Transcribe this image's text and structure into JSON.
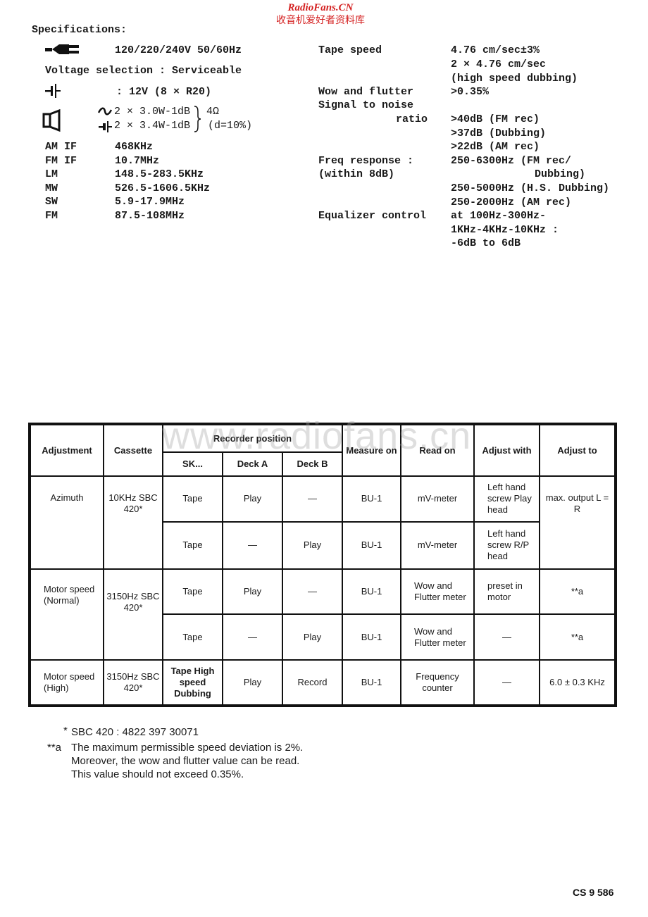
{
  "watermark": {
    "site_en": "RadioFans.CN",
    "site_cn": "收音机爱好者资料库",
    "table_overlay": "www.radiofans.cn"
  },
  "specifications": {
    "heading": "Specifications:",
    "left": {
      "mains": {
        "icon": "mains-plug-icon",
        "value": "120/220/240V 50/60Hz"
      },
      "voltage_selection": "Voltage selection : Serviceable",
      "battery": {
        "icon": "battery-icon",
        "value": ": 12V (8 × R20)"
      },
      "output_power": {
        "icon": "speaker-icon",
        "ac": {
          "icon": "ac-wave-icon",
          "value": "2 × 3.0W-1dB"
        },
        "dc": {
          "icon": "battery-small-icon",
          "value": "2 × 3.4W-1dB"
        },
        "impedance": "4Ω",
        "distortion": "(d=10%)"
      },
      "bands": [
        {
          "label": "AM IF",
          "value": "468KHz"
        },
        {
          "label": "FM IF",
          "value": "10.7MHz"
        },
        {
          "label": "LM",
          "value": "148.5-283.5KHz"
        },
        {
          "label": "MW",
          "value": "526.5-1606.5KHz"
        },
        {
          "label": "SW",
          "value": "5.9-17.9MHz"
        },
        {
          "label": "FM",
          "value": "87.5-108MHz"
        }
      ]
    },
    "right": {
      "tape_speed": {
        "label": "Tape speed",
        "values": [
          "4.76 cm/sec±3%",
          "2 × 4.76 cm/sec",
          "(high speed dubbing)"
        ]
      },
      "wow_flutter": {
        "label": "Wow and flutter",
        "value": ">0.35%"
      },
      "snr": {
        "label_1": "Signal to noise",
        "label_2": "ratio",
        "values": [
          ">40dB (FM rec)",
          ">37dB (Dubbing)",
          ">22dB (AM rec)"
        ]
      },
      "freq_response": {
        "label_1": "Freq response :",
        "label_2": "(within 8dB)",
        "values": [
          "250-6300Hz (FM rec/",
          "Dubbing)",
          "250-5000Hz (H.S. Dubbing)",
          "250-2000Hz (AM rec)"
        ]
      },
      "equalizer": {
        "label": "Equalizer control",
        "values": [
          "at 100Hz-300Hz-",
          "1KHz-4KHz-10KHz :",
          "-6dB to 6dB"
        ]
      }
    }
  },
  "table": {
    "headers": {
      "adjustment": "Adjustment",
      "cassette": "Cassette",
      "recorder_position": "Recorder position",
      "sk": "SK...",
      "deck_a": "Deck A",
      "deck_b": "Deck B",
      "measure_on": "Measure on",
      "read_on": "Read on",
      "adjust_with": "Adjust with",
      "adjust_to": "Adjust to"
    },
    "rows": [
      {
        "adjustment": "Azimuth",
        "cassette": "10KHz SBC 420*",
        "sk": "Tape",
        "deck_a": "Play",
        "deck_b": "—",
        "measure_on": "BU-1",
        "read_on": "mV-meter",
        "adjust_with": "Left hand screw Play head",
        "adjust_to": "max. output L = R"
      },
      {
        "sk": "Tape",
        "deck_a": "—",
        "deck_b": "Play",
        "measure_on": "BU-1",
        "read_on": "mV-meter",
        "adjust_with": "Left hand screw R/P head"
      },
      {
        "adjustment": "Motor speed (Normal)",
        "cassette": "3150Hz SBC 420*",
        "sk": "Tape",
        "deck_a": "Play",
        "deck_b": "—",
        "measure_on": "BU-1",
        "read_on": "Wow and Flutter meter",
        "adjust_with": "preset in motor",
        "adjust_to": "**a"
      },
      {
        "sk": "Tape",
        "deck_a": "—",
        "deck_b": "Play",
        "measure_on": "BU-1",
        "read_on": "Wow and Flutter meter",
        "adjust_with": "—",
        "adjust_to": "**a"
      },
      {
        "adjustment": "Motor speed (High)",
        "cassette": "3150Hz SBC 420*",
        "sk": "Tape High speed Dubbing",
        "deck_a": "Play",
        "deck_b": "Record",
        "measure_on": "BU-1",
        "read_on": "Frequency counter",
        "adjust_with": "—",
        "adjust_to": "6.0 ± 0.3 KHz"
      }
    ]
  },
  "footnotes": {
    "star_mark": "*",
    "star_text": "SBC 420 : 4822 397 30071",
    "a_mark": "**a",
    "a_lines": [
      "The maximum permissible speed deviation is 2%.",
      "Moreover, the wow and flutter value can be read.",
      "This value should not exceed 0.35%."
    ]
  },
  "document_code": "CS 9 586"
}
